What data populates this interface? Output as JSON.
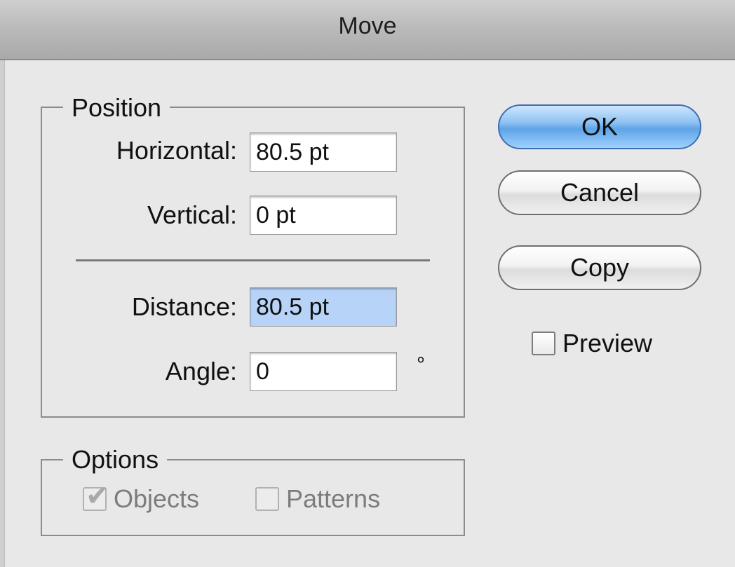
{
  "window": {
    "title": "Move"
  },
  "position": {
    "legend": "Position",
    "horizontal": {
      "label": "Horizontal:",
      "value": "80.5 pt"
    },
    "vertical": {
      "label": "Vertical:",
      "value": "0 pt"
    },
    "distance": {
      "label": "Distance:",
      "value": "80.5 pt"
    },
    "angle": {
      "label": "Angle:",
      "value": "0",
      "unit": "°"
    }
  },
  "options": {
    "legend": "Options",
    "objects": {
      "label": "Objects",
      "checked": true,
      "enabled": false
    },
    "patterns": {
      "label": "Patterns",
      "checked": false,
      "enabled": false
    }
  },
  "buttons": {
    "ok": "OK",
    "cancel": "Cancel",
    "copy": "Copy"
  },
  "preview": {
    "label": "Preview",
    "checked": false
  },
  "colors": {
    "default_button": "#5fa4e8",
    "selected_field": "#b7d3f7"
  },
  "icons": {
    "objects_check": "checkmark-icon",
    "degree": "degree-symbol"
  }
}
